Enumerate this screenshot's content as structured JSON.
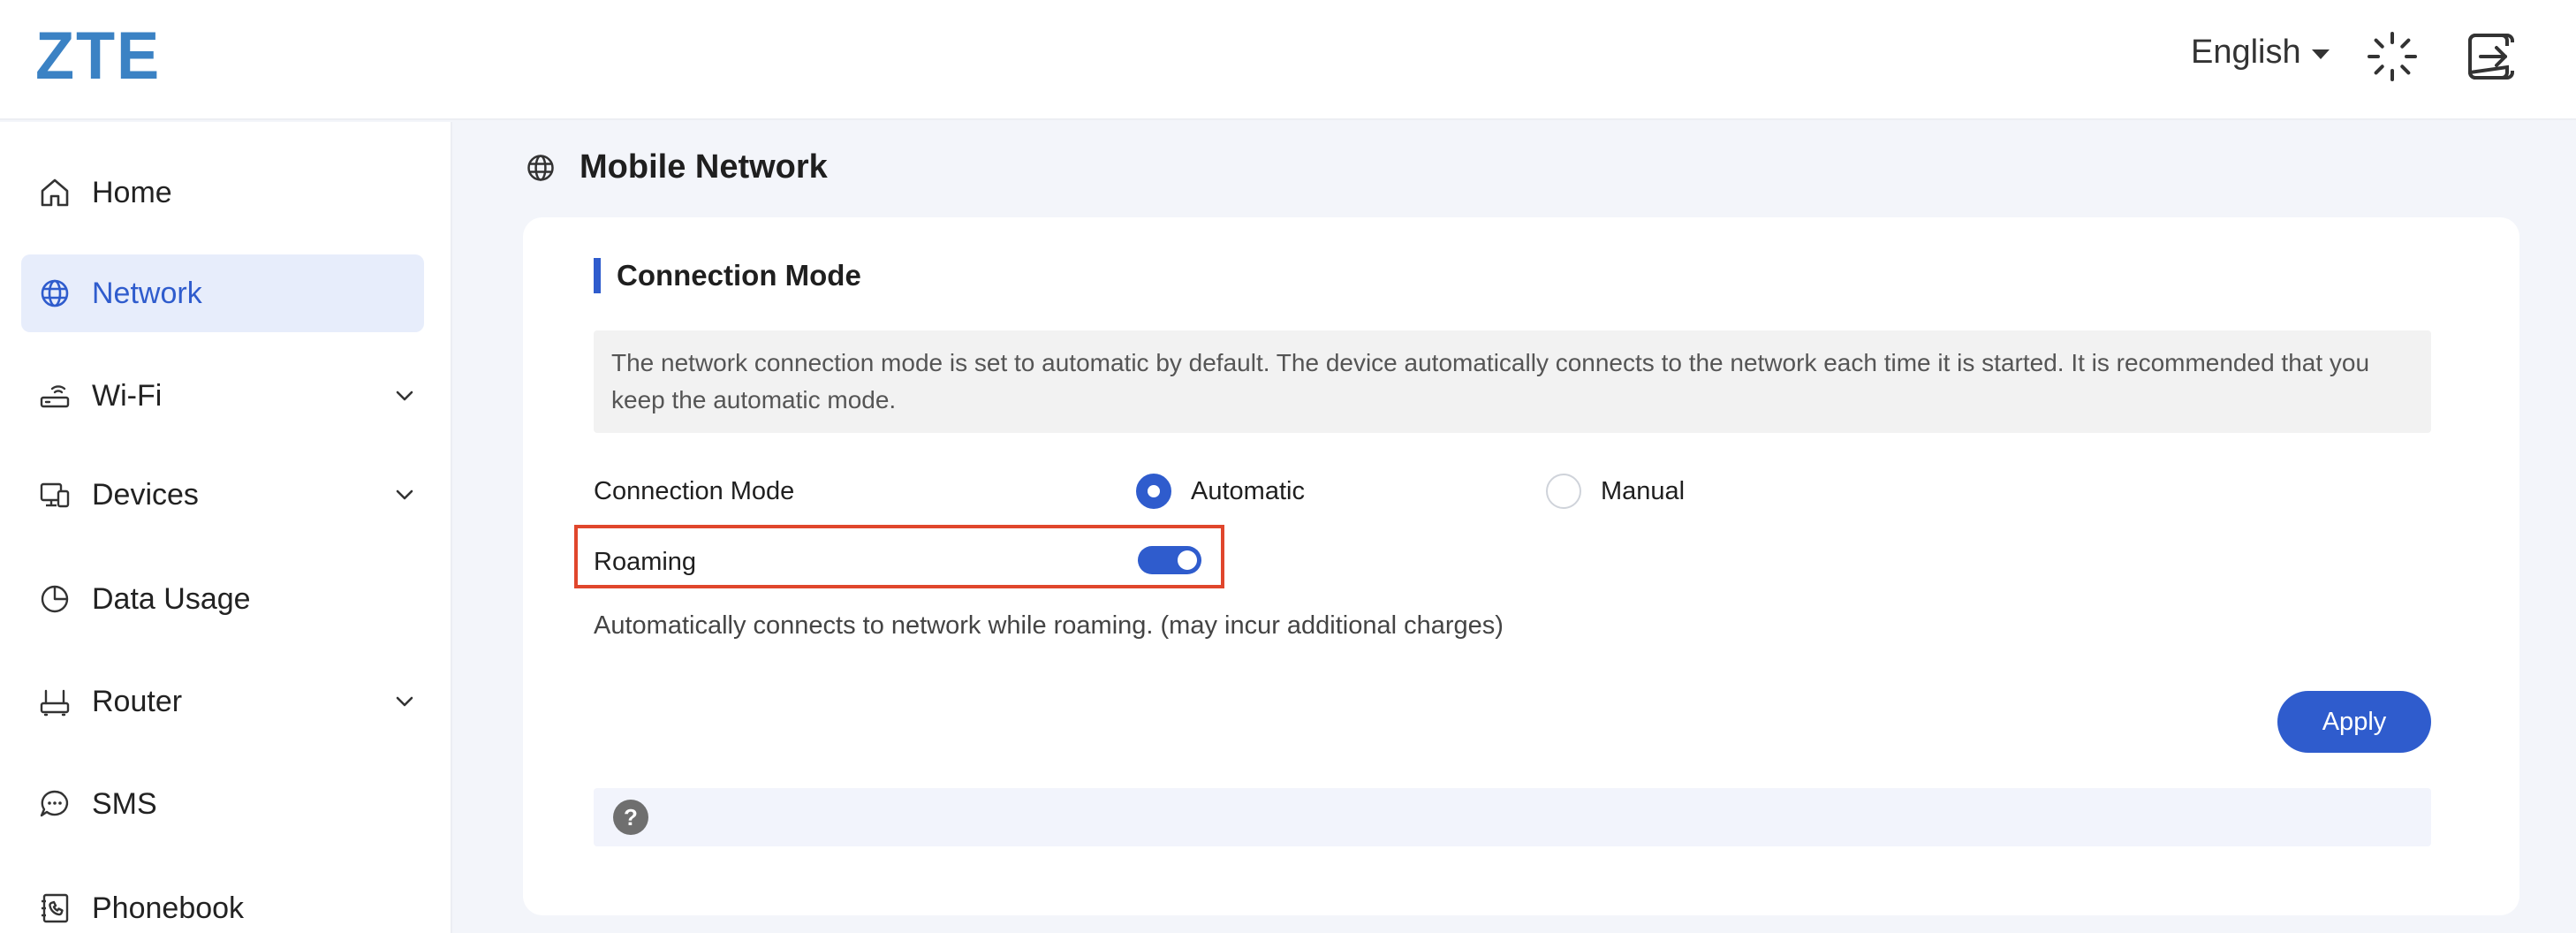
{
  "header": {
    "logo": "ZTE",
    "language": "English",
    "icons": [
      "spinner-icon",
      "logout-icon"
    ]
  },
  "sidebar": {
    "items": [
      {
        "label": "Home",
        "icon": "home-icon",
        "active": false,
        "expandable": false
      },
      {
        "label": "Network",
        "icon": "globe-icon",
        "active": true,
        "expandable": false
      },
      {
        "label": "Wi-Fi",
        "icon": "router-icon",
        "active": false,
        "expandable": true
      },
      {
        "label": "Devices",
        "icon": "devices-icon",
        "active": false,
        "expandable": true
      },
      {
        "label": "Data Usage",
        "icon": "pie-chart-icon",
        "active": false,
        "expandable": false
      },
      {
        "label": "Router",
        "icon": "router-box-icon",
        "active": false,
        "expandable": true
      },
      {
        "label": "SMS",
        "icon": "chat-icon",
        "active": false,
        "expandable": false
      },
      {
        "label": "Phonebook",
        "icon": "phone-book-icon",
        "active": false,
        "expandable": false
      }
    ]
  },
  "main": {
    "title": "Mobile Network",
    "section_title": "Connection Mode",
    "notice": "The network connection mode is set to automatic by default. The device automatically connects to the network each time it is started. It is recommended that you keep the automatic mode.",
    "connection_mode": {
      "label": "Connection Mode",
      "options": [
        "Automatic",
        "Manual"
      ],
      "selected": "Automatic"
    },
    "roaming": {
      "label": "Roaming",
      "enabled": true,
      "description": "Automatically connects to network while roaming. (may incur additional charges)"
    },
    "apply_label": "Apply",
    "help_glyph": "?"
  },
  "colors": {
    "accent": "#2f5ccd",
    "logo": "#3b82c4",
    "highlight": "#e0462c",
    "background": "#f3f5fa"
  }
}
